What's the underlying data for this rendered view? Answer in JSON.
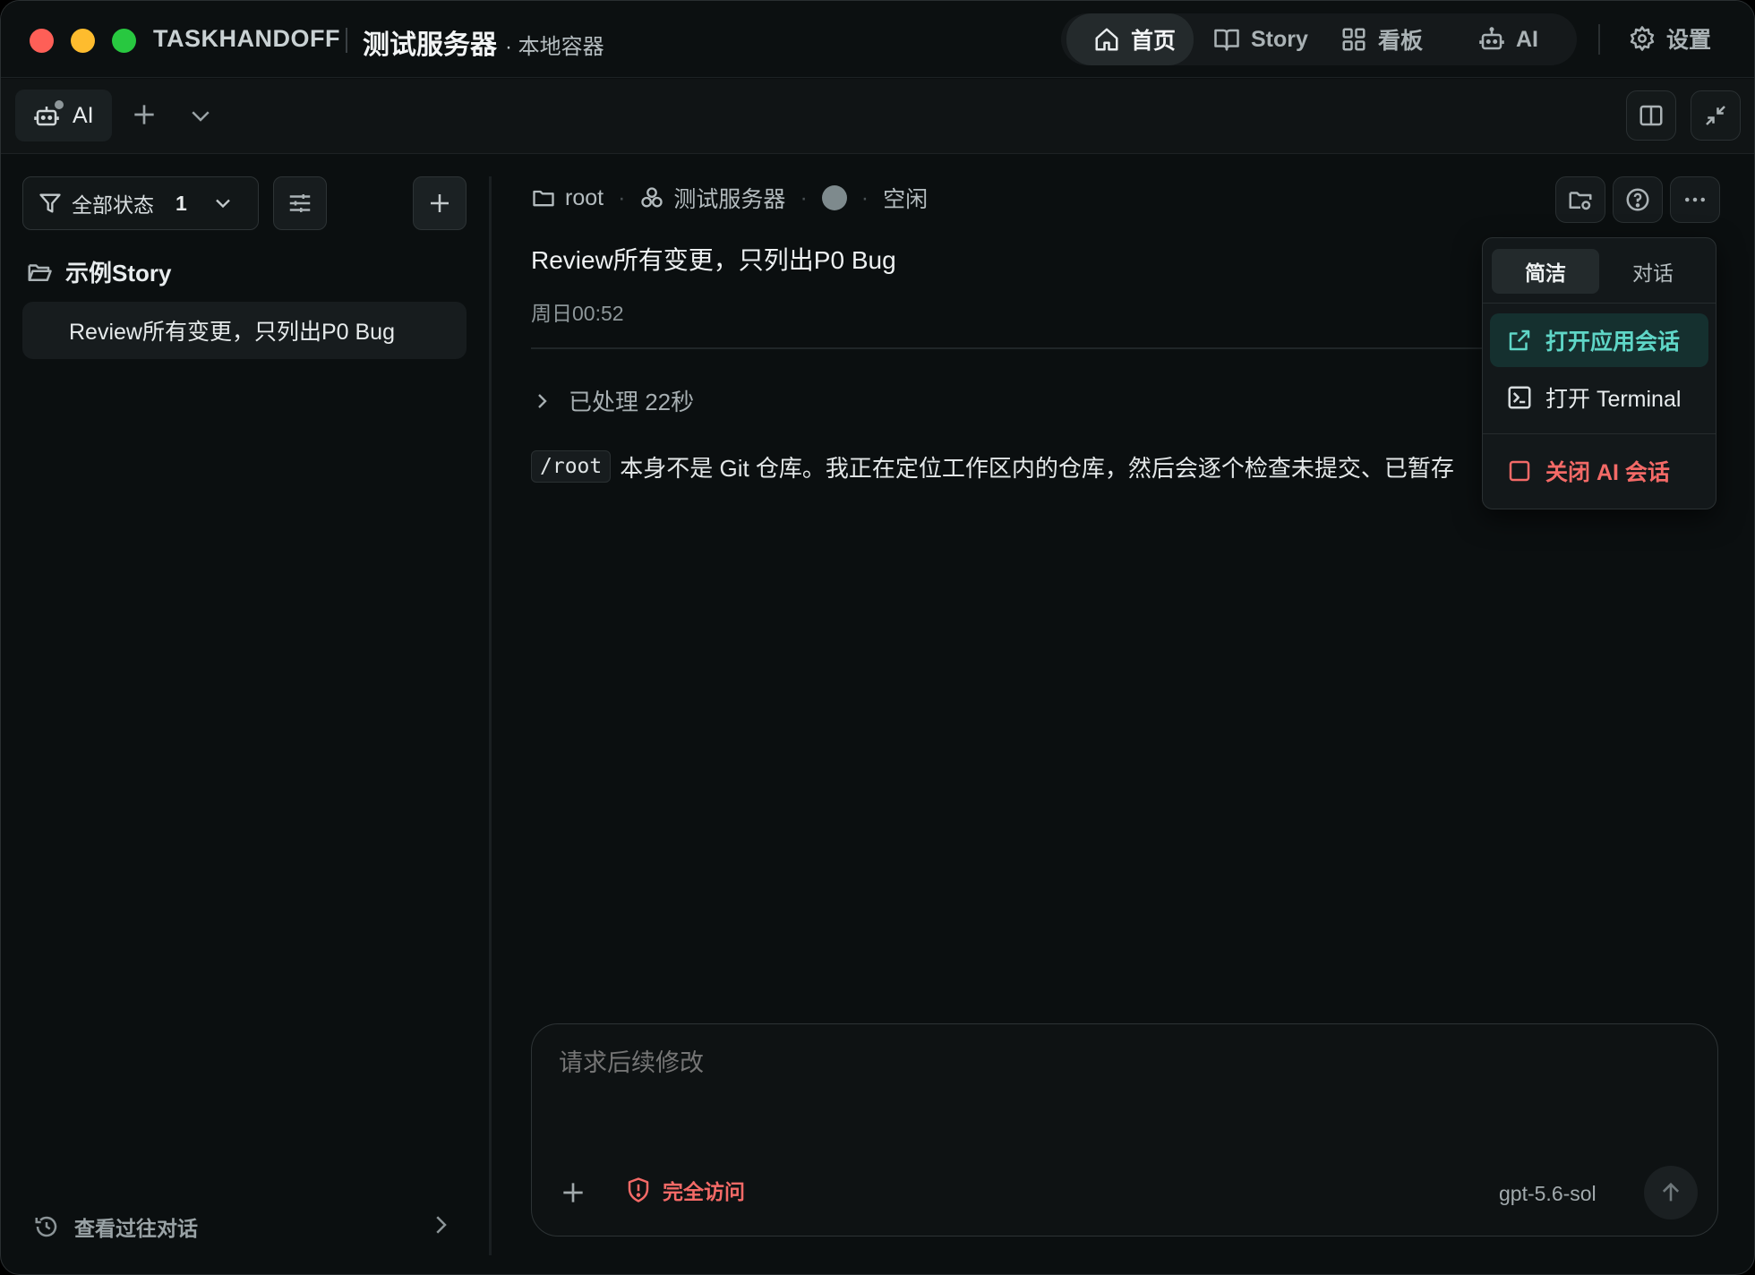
{
  "titlebar": {
    "app_name": "TASKHANDOFF",
    "server_name": "测试服务器",
    "server_sub": "· 本地容器",
    "nav": [
      {
        "label": "首页",
        "icon": "home-icon",
        "active": true
      },
      {
        "label": "Story",
        "icon": "book-icon",
        "active": false
      },
      {
        "label": "看板",
        "icon": "grid-icon",
        "active": false
      },
      {
        "label": "AI",
        "icon": "robot-icon",
        "active": false
      }
    ],
    "settings_label": "设置"
  },
  "tabbar": {
    "active_tab_label": "AI"
  },
  "sidebar": {
    "filter_label": "全部状态",
    "filter_count": "1",
    "group_name": "示例Story",
    "session_title": "Review所有变更，只列出P0 Bug",
    "history_label": "查看过往对话"
  },
  "main": {
    "breadcrumb": {
      "folder": "root",
      "server": "测试服务器",
      "status": "空闲"
    },
    "title": "Review所有变更，只列出P0 Bug",
    "time": "周日00:52",
    "processed_label": "已处理 22秒",
    "message_code": "/root",
    "message_text": "本身不是 Git 仓库。我正在定位工作区内的仓库，然后会逐个检查未提交、已暂存"
  },
  "menu": {
    "segments": [
      "简洁",
      "对话"
    ],
    "active_segment": "简洁",
    "open_session": "打开应用会话",
    "open_terminal": "打开 Terminal",
    "close_ai": "关闭 AI 会话"
  },
  "composer": {
    "placeholder": "请求后续修改",
    "access_label": "完全访问",
    "model": "gpt-5.6-sol"
  },
  "colors": {
    "accent_teal": "#5fd6c7",
    "danger_red": "#f46a67",
    "background": "#0b0f10"
  }
}
